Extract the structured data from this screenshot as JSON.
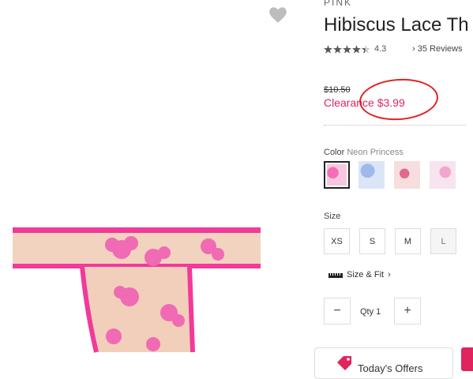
{
  "product": {
    "brand": "PINK",
    "title": "Hibiscus Lace Th",
    "rating": {
      "value": "4.3",
      "stars_filled": 4.3,
      "stars_total": 5
    },
    "reviews_label": "35 Reviews",
    "original_price": "$10.50",
    "clearance_price": "Clearance $3.99",
    "color": {
      "label": "Color",
      "value": "Neon Princess"
    },
    "swatches": [
      {
        "name": "neon-princess",
        "selected": true
      },
      {
        "name": "blue-lace",
        "selected": false
      },
      {
        "name": "pink-floral",
        "selected": false
      },
      {
        "name": "soft-pink-print",
        "selected": false
      }
    ],
    "size": {
      "label": "Size",
      "options": [
        "XS",
        "S",
        "M",
        "L"
      ],
      "disabled": [
        "L"
      ]
    },
    "size_fit_label": "Size & Fit",
    "quantity": {
      "label": "Qty 1",
      "minus": "−",
      "plus": "+"
    },
    "offers_label": "Today's Offers"
  },
  "colors": {
    "accent": "#e0245e",
    "annotation": "#e32020"
  },
  "icons": [
    "heart-icon",
    "star-icon",
    "chevron-right-icon",
    "ruler-icon",
    "minus-icon",
    "plus-icon",
    "tag-icon"
  ]
}
